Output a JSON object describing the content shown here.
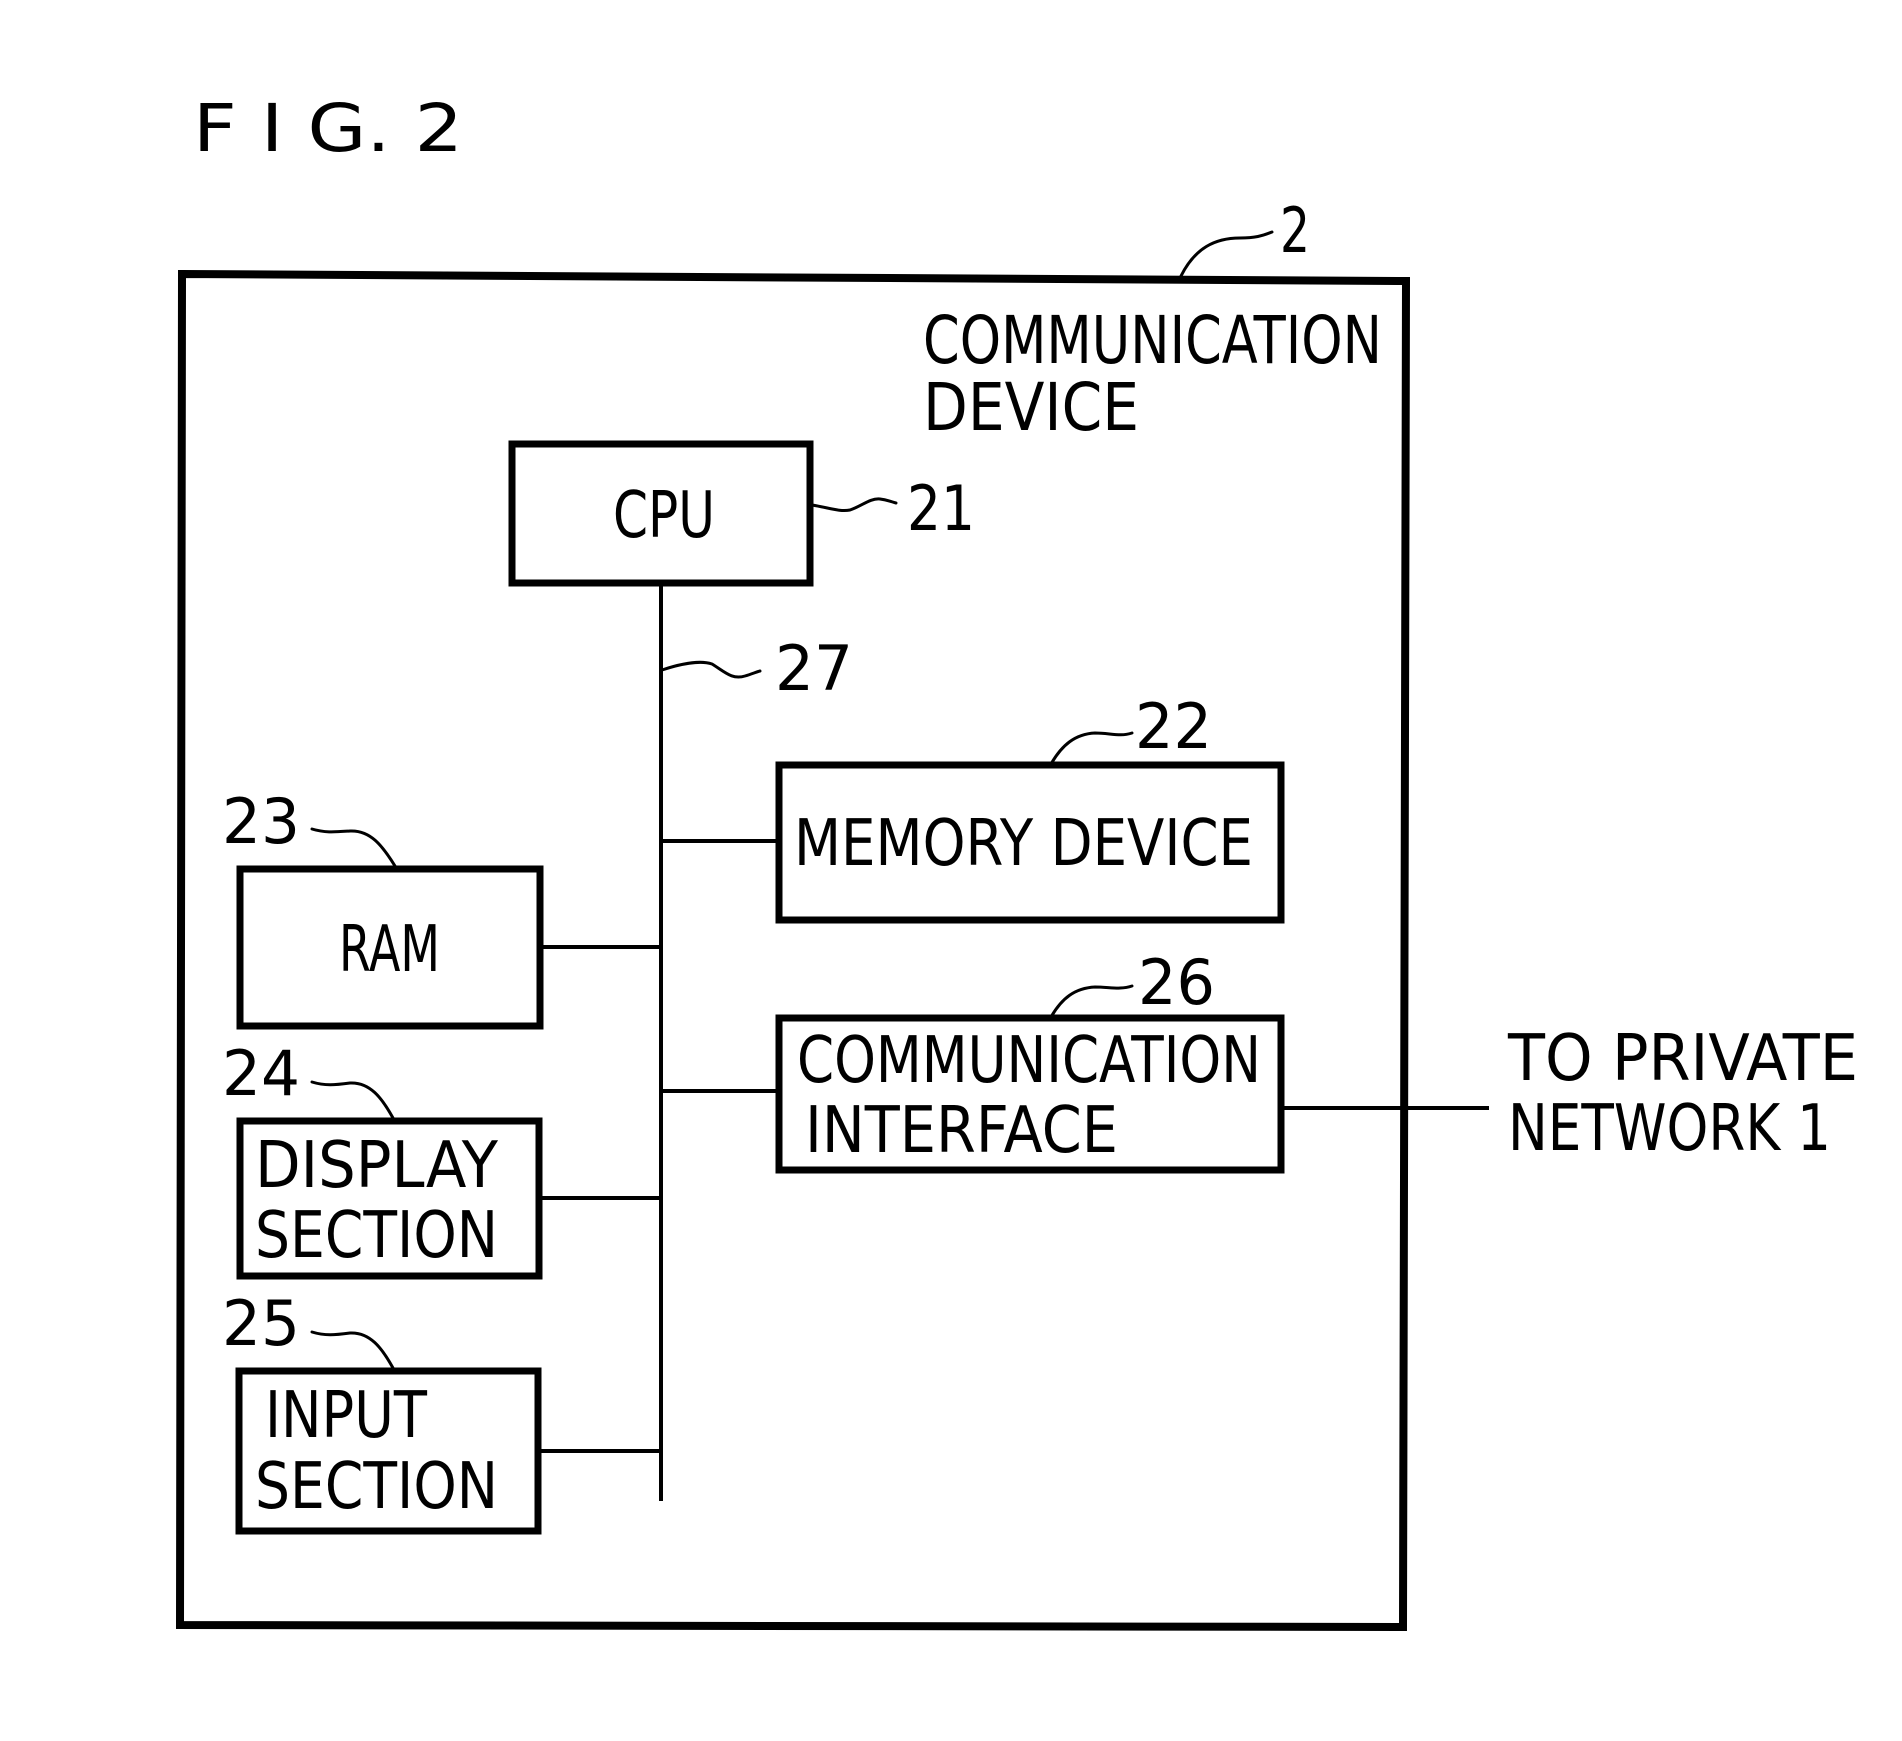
{
  "figure": {
    "title": "F I G. 2",
    "device": {
      "ref": "2",
      "label_lines": [
        "COMMUNICATION",
        "DEVICE"
      ]
    },
    "bus": {
      "ref": "27"
    },
    "components": {
      "cpu": {
        "ref": "21",
        "label_lines": [
          "CPU"
        ]
      },
      "memory": {
        "ref": "22",
        "label_lines": [
          "MEMORY DEVICE"
        ]
      },
      "ram": {
        "ref": "23",
        "label_lines": [
          "RAM"
        ]
      },
      "display": {
        "ref": "24",
        "label_lines": [
          "DISPLAY",
          "SECTION"
        ]
      },
      "input": {
        "ref": "25",
        "label_lines": [
          "INPUT",
          "SECTION"
        ]
      },
      "comm_interface": {
        "ref": "26",
        "label_lines": [
          "COMMUNICATION",
          "INTERFACE"
        ]
      }
    },
    "external": {
      "label_lines": [
        "TO PRIVATE",
        "NETWORK 1"
      ]
    },
    "colors": {
      "ink": "#000000",
      "paper": "#ffffff"
    }
  }
}
